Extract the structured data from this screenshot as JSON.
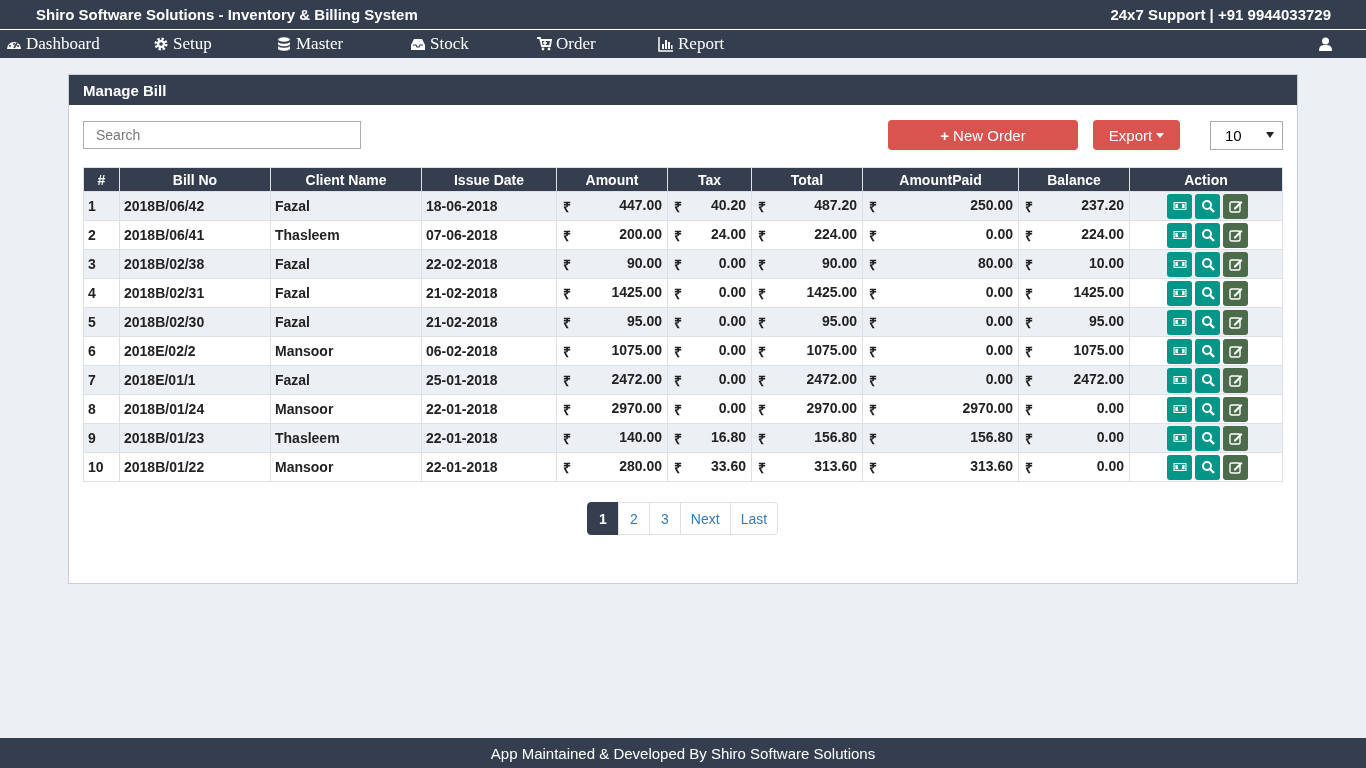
{
  "header": {
    "title": "Shiro Software Solutions - Inventory & Billing System",
    "support": "24x7 Support | +91 9944033729"
  },
  "nav": [
    {
      "label": "Dashboard"
    },
    {
      "label": "Setup"
    },
    {
      "label": "Master"
    },
    {
      "label": "Stock"
    },
    {
      "label": "Order"
    },
    {
      "label": "Report"
    }
  ],
  "panel": {
    "title": "Manage Bill"
  },
  "search": {
    "placeholder": "Search"
  },
  "new_order_button": {
    "icon": "+",
    "label": "New Order"
  },
  "export_button": {
    "label": "Export"
  },
  "page_size": {
    "value": "10"
  },
  "table": {
    "columns": [
      "#",
      "Bill No",
      "Client Name",
      "Issue Date",
      "Amount",
      "Tax",
      "Total",
      "AmountPaid",
      "Balance",
      "Action"
    ],
    "rows": [
      {
        "cells": [
          "1",
          "2018B/06/42",
          "Fazal",
          "18-06-2018",
          [
            "₹",
            "447.00"
          ],
          [
            "₹",
            "40.20"
          ],
          [
            "₹",
            "487.20"
          ],
          [
            "₹",
            "250.00"
          ],
          [
            "₹",
            "237.20"
          ]
        ]
      },
      {
        "cells": [
          "2",
          "2018B/06/41",
          "Thasleem",
          "07-06-2018",
          [
            "₹",
            "200.00"
          ],
          [
            "₹",
            "24.00"
          ],
          [
            "₹",
            "224.00"
          ],
          [
            "₹",
            "0.00"
          ],
          [
            "₹",
            "224.00"
          ]
        ]
      },
      {
        "cells": [
          "3",
          "2018B/02/38",
          "Fazal",
          "22-02-2018",
          [
            "₹",
            "90.00"
          ],
          [
            "₹",
            "0.00"
          ],
          [
            "₹",
            "90.00"
          ],
          [
            "₹",
            "80.00"
          ],
          [
            "₹",
            "10.00"
          ]
        ]
      },
      {
        "cells": [
          "4",
          "2018B/02/31",
          "Fazal",
          "21-02-2018",
          [
            "₹",
            "1425.00"
          ],
          [
            "₹",
            "0.00"
          ],
          [
            "₹",
            "1425.00"
          ],
          [
            "₹",
            "0.00"
          ],
          [
            "₹",
            "1425.00"
          ]
        ]
      },
      {
        "cells": [
          "5",
          "2018B/02/30",
          "Fazal",
          "21-02-2018",
          [
            "₹",
            "95.00"
          ],
          [
            "₹",
            "0.00"
          ],
          [
            "₹",
            "95.00"
          ],
          [
            "₹",
            "0.00"
          ],
          [
            "₹",
            "95.00"
          ]
        ]
      },
      {
        "cells": [
          "6",
          "2018E/02/2",
          "Mansoor",
          "06-02-2018",
          [
            "₹",
            "1075.00"
          ],
          [
            "₹",
            "0.00"
          ],
          [
            "₹",
            "1075.00"
          ],
          [
            "₹",
            "0.00"
          ],
          [
            "₹",
            "1075.00"
          ]
        ]
      },
      {
        "cells": [
          "7",
          "2018E/01/1",
          "Fazal",
          "25-01-2018",
          [
            "₹",
            "2472.00"
          ],
          [
            "₹",
            "0.00"
          ],
          [
            "₹",
            "2472.00"
          ],
          [
            "₹",
            "0.00"
          ],
          [
            "₹",
            "2472.00"
          ]
        ]
      },
      {
        "cells": [
          "8",
          "2018B/01/24",
          "Mansoor",
          "22-01-2018",
          [
            "₹",
            "2970.00"
          ],
          [
            "₹",
            "0.00"
          ],
          [
            "₹",
            "2970.00"
          ],
          [
            "₹",
            "2970.00"
          ],
          [
            "₹",
            "0.00"
          ]
        ]
      },
      {
        "cells": [
          "9",
          "2018B/01/23",
          "Thasleem",
          "22-01-2018",
          [
            "₹",
            "140.00"
          ],
          [
            "₹",
            "16.80"
          ],
          [
            "₹",
            "156.80"
          ],
          [
            "₹",
            "156.80"
          ],
          [
            "₹",
            "0.00"
          ]
        ]
      },
      {
        "cells": [
          "10",
          "2018B/01/22",
          "Mansoor",
          "22-01-2018",
          [
            "₹",
            "280.00"
          ],
          [
            "₹",
            "33.60"
          ],
          [
            "₹",
            "313.60"
          ],
          [
            "₹",
            "313.60"
          ],
          [
            "₹",
            "0.00"
          ]
        ]
      }
    ]
  },
  "pagination": [
    {
      "label": "1",
      "selected": true
    },
    {
      "label": "2",
      "selected": false
    },
    {
      "label": "3",
      "selected": false
    },
    {
      "label": "Next",
      "selected": false
    },
    {
      "label": "Last",
      "selected": false
    }
  ],
  "footer": "App Maintained & Developed By Shiro Software Solutions"
}
